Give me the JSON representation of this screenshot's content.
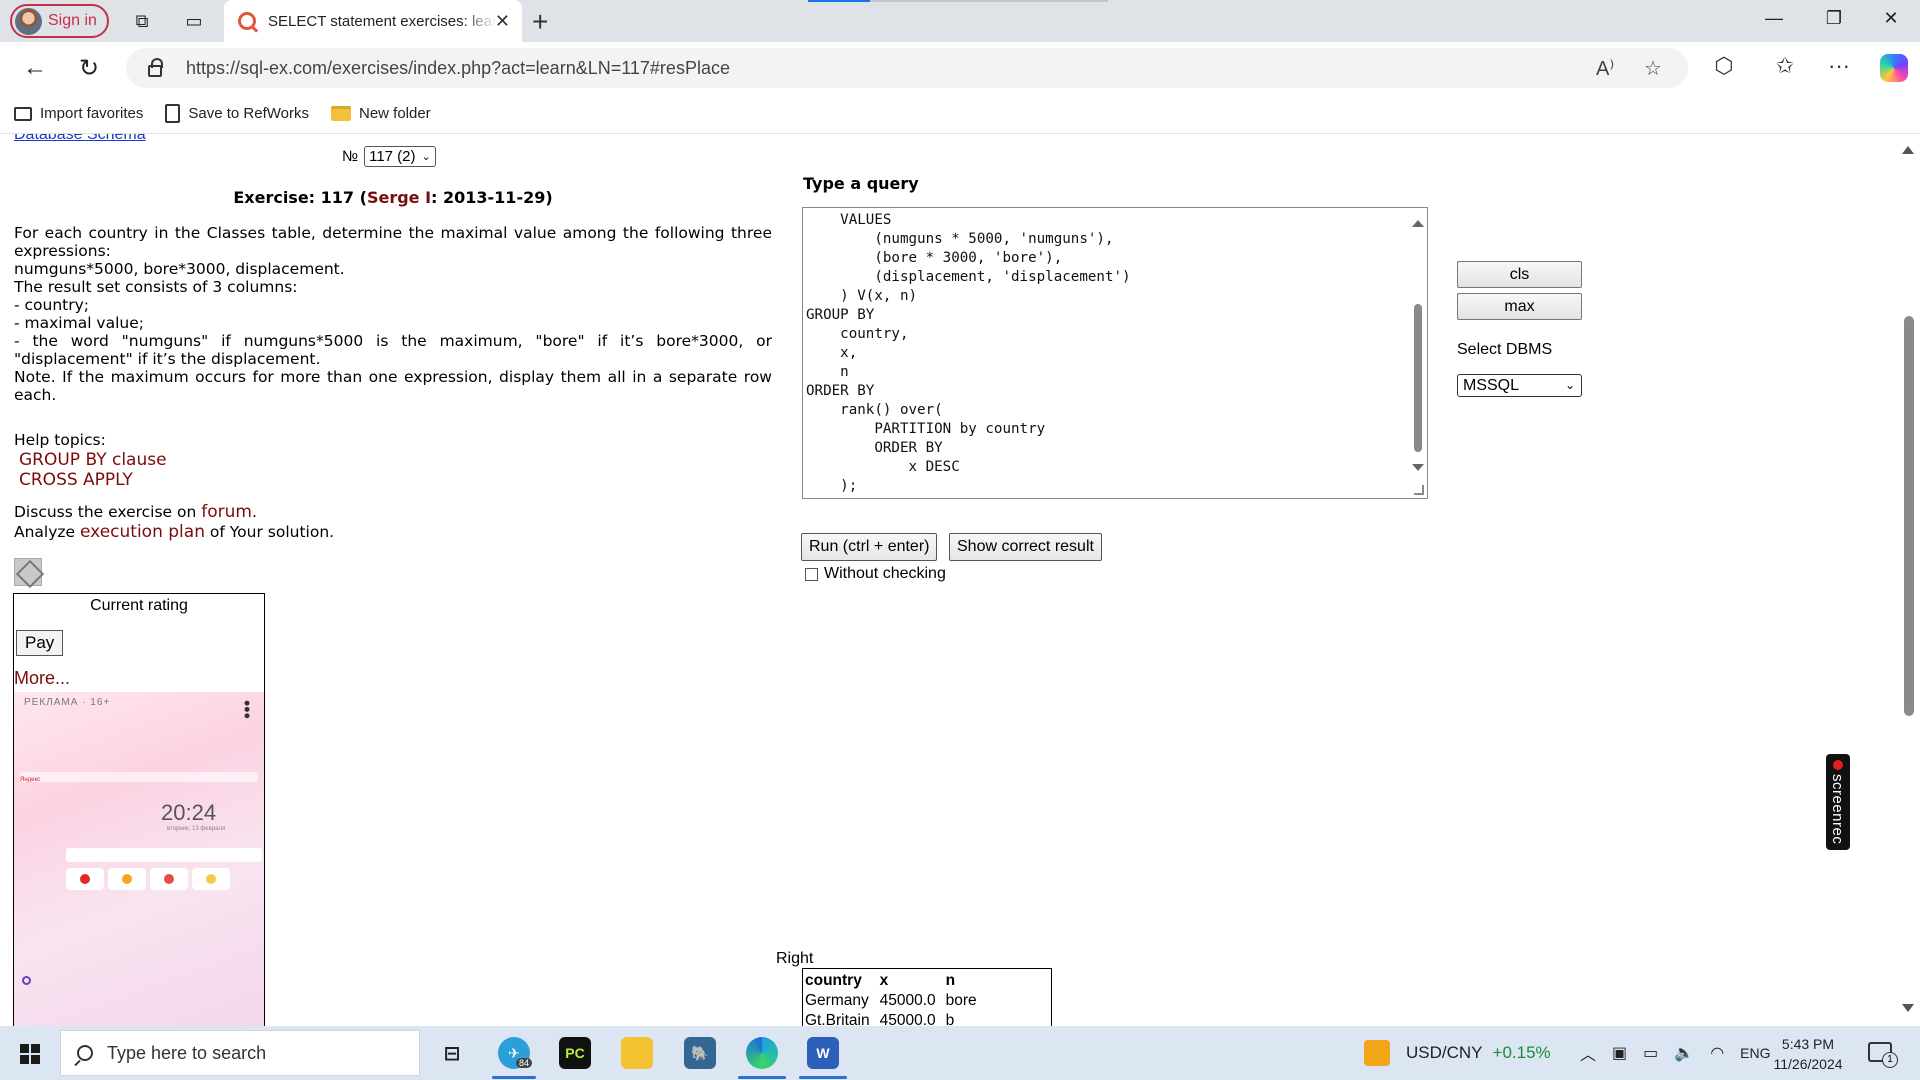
{
  "browser": {
    "signin_label": "Sign in",
    "tab_title": "SELECT statement exercises: learning stage",
    "url": "https://sql-ex.com/exercises/index.php?act=learn&LN=117#resPlace",
    "favorites": [
      "Import favorites",
      "Save to RefWorks",
      "New folder"
    ]
  },
  "page": {
    "db_schema_link": "Database Schema",
    "number_label": "№",
    "number_value": "117 (2)",
    "exercise_prefix": "Exercise: 117 (",
    "exercise_author": "Serge I",
    "exercise_suffix": ": 2013-11-29)",
    "exercise_text": "For each country in the Classes table, determine the maximal value among the following three expressions:\nnumguns*5000, bore*3000, displacement.\nThe result set consists of 3 columns:\n- country;\n- maximal value;\n- the word \"numguns\" if numguns*5000 is the maximum, \"bore\" if it’s bore*3000, or \"displacement\" if it’s the displacement.\nNote. If the maximum occurs for more than one expression, display them all in a separate row each.",
    "help_label": "Help topics:",
    "help_topics": [
      "GROUP BY clause",
      "CROSS APPLY"
    ],
    "discuss_prefix": "Discuss the exercise on ",
    "discuss_link": "forum",
    "discuss_suffix": ".",
    "analyze_prefix": "Analyze ",
    "analyze_link": "execution plan",
    "analyze_suffix": " of Your solution.",
    "rating_label": "Current rating",
    "pay_label": "Pay",
    "more_label": "More...",
    "ad": {
      "label": "РЕКЛАМА · 16+",
      "clock": "20:24",
      "date": "вторник, 13 февраля",
      "brand": "Яндекс"
    },
    "query_label": "Type a query",
    "query_text": "    VALUES\n        (numguns * 5000, 'numguns'),\n        (bore * 3000, 'bore'),\n        (displacement, 'displacement')\n    ) V(x, n)\nGROUP BY\n    country,\n    x,\n    n\nORDER BY\n    rank() over(\n        PARTITION by country\n        ORDER BY\n            x DESC\n    );",
    "cls_label": "cls",
    "max_label": "max",
    "dbms_label": "Select DBMS",
    "dbms_value": "MSSQL",
    "run_label": "Run (ctrl + enter)",
    "show_label": "Show correct result",
    "without_checking_label": "Without checking",
    "right_label": "Right",
    "result_table": {
      "columns": [
        "country",
        "x",
        "n"
      ],
      "rows": [
        [
          "Germany",
          "45000.0",
          "bore"
        ],
        [
          "Gt.Britain",
          "45000.0",
          "b"
        ]
      ]
    },
    "screenrec_label": "screenrec"
  },
  "taskbar": {
    "search_placeholder": "Type here to search",
    "telegram_badge": "84",
    "ticker_label": "USD/CNY",
    "ticker_change": "+0.15%",
    "language": "ENG",
    "time": "5:43 PM",
    "date": "11/26/2024",
    "notification_count": "1"
  }
}
